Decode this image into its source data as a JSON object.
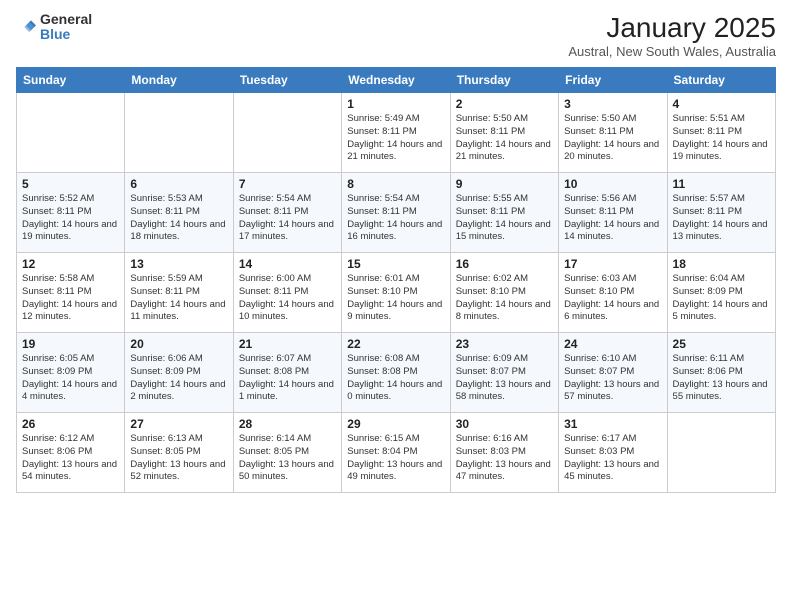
{
  "logo": {
    "general": "General",
    "blue": "Blue"
  },
  "header": {
    "month_year": "January 2025",
    "location": "Austral, New South Wales, Australia"
  },
  "days_of_week": [
    "Sunday",
    "Monday",
    "Tuesday",
    "Wednesday",
    "Thursday",
    "Friday",
    "Saturday"
  ],
  "weeks": [
    [
      {
        "day": "",
        "info": ""
      },
      {
        "day": "",
        "info": ""
      },
      {
        "day": "",
        "info": ""
      },
      {
        "day": "1",
        "info": "Sunrise: 5:49 AM\nSunset: 8:11 PM\nDaylight: 14 hours\nand 21 minutes."
      },
      {
        "day": "2",
        "info": "Sunrise: 5:50 AM\nSunset: 8:11 PM\nDaylight: 14 hours\nand 21 minutes."
      },
      {
        "day": "3",
        "info": "Sunrise: 5:50 AM\nSunset: 8:11 PM\nDaylight: 14 hours\nand 20 minutes."
      },
      {
        "day": "4",
        "info": "Sunrise: 5:51 AM\nSunset: 8:11 PM\nDaylight: 14 hours\nand 19 minutes."
      }
    ],
    [
      {
        "day": "5",
        "info": "Sunrise: 5:52 AM\nSunset: 8:11 PM\nDaylight: 14 hours\nand 19 minutes."
      },
      {
        "day": "6",
        "info": "Sunrise: 5:53 AM\nSunset: 8:11 PM\nDaylight: 14 hours\nand 18 minutes."
      },
      {
        "day": "7",
        "info": "Sunrise: 5:54 AM\nSunset: 8:11 PM\nDaylight: 14 hours\nand 17 minutes."
      },
      {
        "day": "8",
        "info": "Sunrise: 5:54 AM\nSunset: 8:11 PM\nDaylight: 14 hours\nand 16 minutes."
      },
      {
        "day": "9",
        "info": "Sunrise: 5:55 AM\nSunset: 8:11 PM\nDaylight: 14 hours\nand 15 minutes."
      },
      {
        "day": "10",
        "info": "Sunrise: 5:56 AM\nSunset: 8:11 PM\nDaylight: 14 hours\nand 14 minutes."
      },
      {
        "day": "11",
        "info": "Sunrise: 5:57 AM\nSunset: 8:11 PM\nDaylight: 14 hours\nand 13 minutes."
      }
    ],
    [
      {
        "day": "12",
        "info": "Sunrise: 5:58 AM\nSunset: 8:11 PM\nDaylight: 14 hours\nand 12 minutes."
      },
      {
        "day": "13",
        "info": "Sunrise: 5:59 AM\nSunset: 8:11 PM\nDaylight: 14 hours\nand 11 minutes."
      },
      {
        "day": "14",
        "info": "Sunrise: 6:00 AM\nSunset: 8:11 PM\nDaylight: 14 hours\nand 10 minutes."
      },
      {
        "day": "15",
        "info": "Sunrise: 6:01 AM\nSunset: 8:10 PM\nDaylight: 14 hours\nand 9 minutes."
      },
      {
        "day": "16",
        "info": "Sunrise: 6:02 AM\nSunset: 8:10 PM\nDaylight: 14 hours\nand 8 minutes."
      },
      {
        "day": "17",
        "info": "Sunrise: 6:03 AM\nSunset: 8:10 PM\nDaylight: 14 hours\nand 6 minutes."
      },
      {
        "day": "18",
        "info": "Sunrise: 6:04 AM\nSunset: 8:09 PM\nDaylight: 14 hours\nand 5 minutes."
      }
    ],
    [
      {
        "day": "19",
        "info": "Sunrise: 6:05 AM\nSunset: 8:09 PM\nDaylight: 14 hours\nand 4 minutes."
      },
      {
        "day": "20",
        "info": "Sunrise: 6:06 AM\nSunset: 8:09 PM\nDaylight: 14 hours\nand 2 minutes."
      },
      {
        "day": "21",
        "info": "Sunrise: 6:07 AM\nSunset: 8:08 PM\nDaylight: 14 hours\nand 1 minute."
      },
      {
        "day": "22",
        "info": "Sunrise: 6:08 AM\nSunset: 8:08 PM\nDaylight: 14 hours\nand 0 minutes."
      },
      {
        "day": "23",
        "info": "Sunrise: 6:09 AM\nSunset: 8:07 PM\nDaylight: 13 hours\nand 58 minutes."
      },
      {
        "day": "24",
        "info": "Sunrise: 6:10 AM\nSunset: 8:07 PM\nDaylight: 13 hours\nand 57 minutes."
      },
      {
        "day": "25",
        "info": "Sunrise: 6:11 AM\nSunset: 8:06 PM\nDaylight: 13 hours\nand 55 minutes."
      }
    ],
    [
      {
        "day": "26",
        "info": "Sunrise: 6:12 AM\nSunset: 8:06 PM\nDaylight: 13 hours\nand 54 minutes."
      },
      {
        "day": "27",
        "info": "Sunrise: 6:13 AM\nSunset: 8:05 PM\nDaylight: 13 hours\nand 52 minutes."
      },
      {
        "day": "28",
        "info": "Sunrise: 6:14 AM\nSunset: 8:05 PM\nDaylight: 13 hours\nand 50 minutes."
      },
      {
        "day": "29",
        "info": "Sunrise: 6:15 AM\nSunset: 8:04 PM\nDaylight: 13 hours\nand 49 minutes."
      },
      {
        "day": "30",
        "info": "Sunrise: 6:16 AM\nSunset: 8:03 PM\nDaylight: 13 hours\nand 47 minutes."
      },
      {
        "day": "31",
        "info": "Sunrise: 6:17 AM\nSunset: 8:03 PM\nDaylight: 13 hours\nand 45 minutes."
      },
      {
        "day": "",
        "info": ""
      }
    ]
  ]
}
